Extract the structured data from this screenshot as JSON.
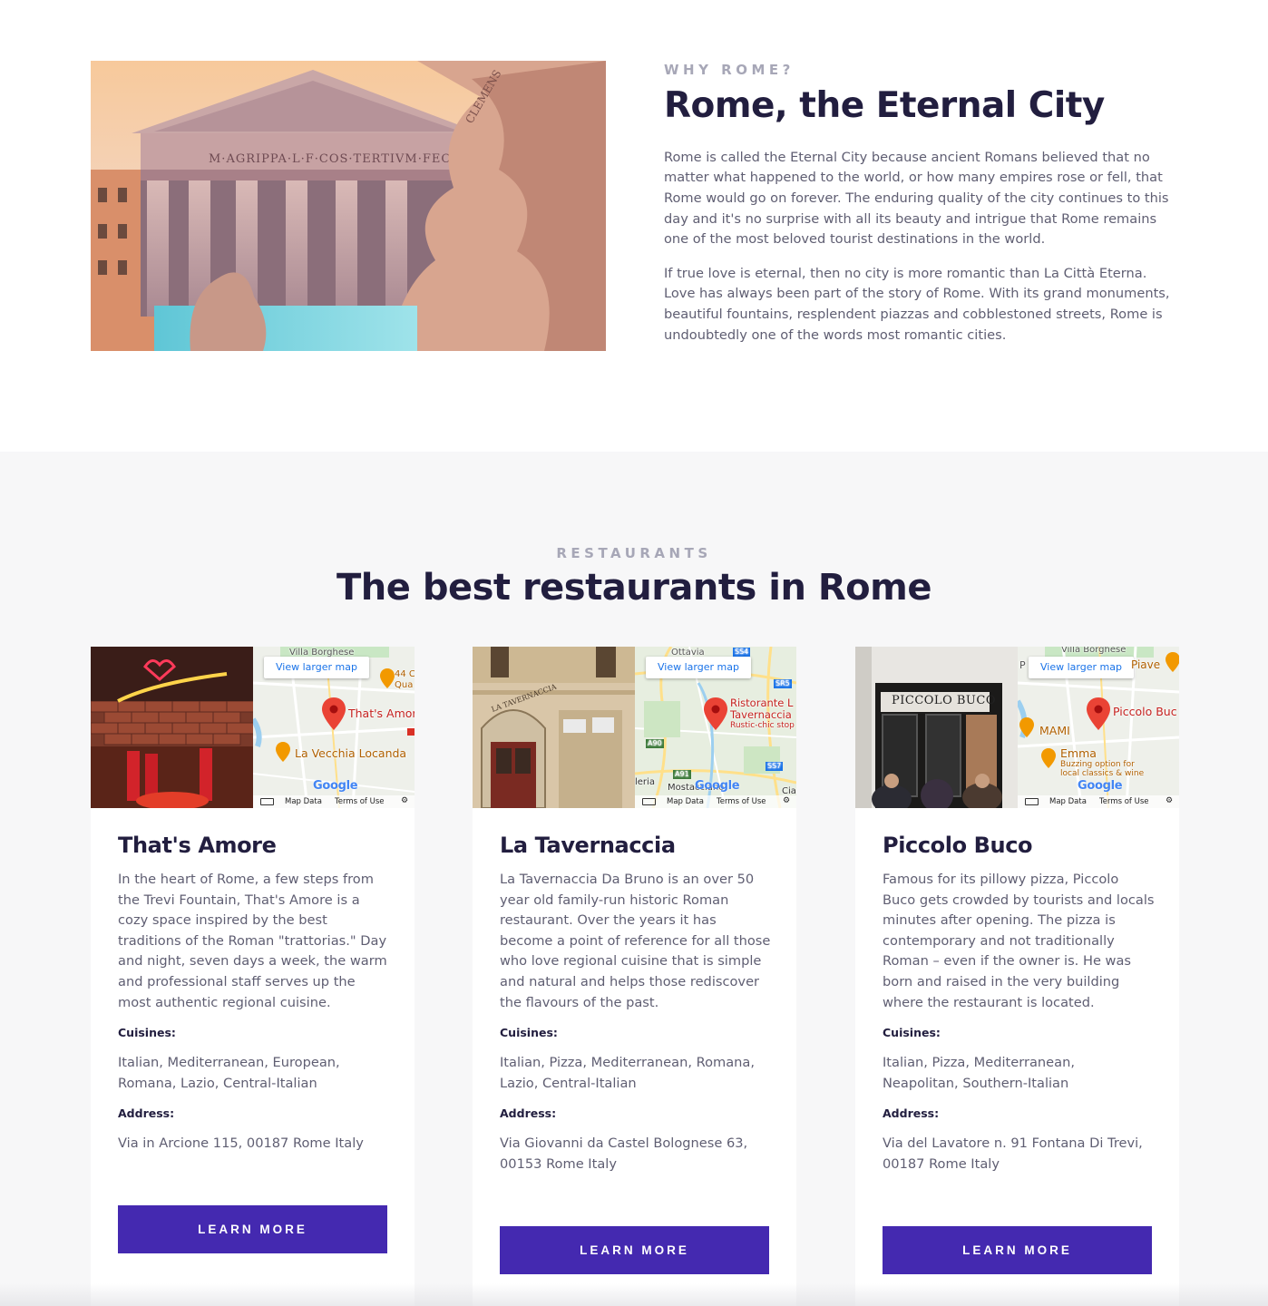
{
  "colors": {
    "accent": "#4429b0",
    "heading": "#221e3f",
    "body_text": "#5f5e72",
    "eyebrow": "#a7a7b7",
    "section_bg": "#f7f7f8"
  },
  "why": {
    "eyebrow": "WHY ROME?",
    "title": "Rome, the Eternal City",
    "paragraphs": [
      "Rome is called the Eternal City because ancient Romans believed that no matter what happened to the world, or how many empires rose or fell, that Rome would go on forever. The enduring quality of the city continues to this day and it's no surprise with all its beauty and intrigue that Rome remains one of the most beloved tourist destinations in the world.",
      "If true love is eternal, then no city is more romantic than La Città Eterna. Love has always been part of the story of Rome. With its grand monuments, beautiful fountains, resplendent piazzas and cobblestoned streets, Rome is undoubtedly one of the words most romantic cities."
    ],
    "image_inscription": "M·AGRIPPA·L·F·COS·TERTIVM·FECIT"
  },
  "restaurants": {
    "eyebrow": "RESTAURANTS",
    "title": "The best restaurants in Rome",
    "map_common": {
      "larger_map": "View larger map",
      "map_data": "Map Data",
      "terms": "Terms of Use",
      "google": "Google"
    },
    "cards": [
      {
        "name": "That's Amore",
        "description": "In the heart of Rome, a few steps from the Trevi Fountain, That's Amore is a cozy space inspired by the best traditions of the Roman \"trattorias.\" Day and night, seven days a week, the warm and professional staff serves up the most authentic regional cuisine.",
        "cuisines_label": "Cuisines:",
        "cuisines": "Italian, Mediterranean, European, Romana, Lazio, Central-Italian",
        "address_label": "Address:",
        "address": "Via in Arcione 115, 00187 Rome Italy",
        "button": "LEARN MORE",
        "map": {
          "top_label": "Villa Borghese",
          "pin_label": "That's Amor",
          "poi1": "La Vecchia Locanda",
          "poi2": "44 C",
          "poi2b": "Qua"
        }
      },
      {
        "name": "La Tavernaccia",
        "description": "La Tavernaccia Da Bruno is an over 50 year old family-run historic Roman restaurant. Over the years it has become a point of reference for all those who love regional cuisine that is simple and natural and helps those rediscover the flavours of the past.",
        "cuisines_label": "Cuisines:",
        "cuisines": "Italian, Pizza, Mediterranean, Romana, Lazio, Central-Italian",
        "address_label": "Address:",
        "address": "Via Giovanni da Castel Bolognese 63, 00153 Rome Italy",
        "button": "LEARN MORE",
        "map": {
          "top_label": "Ottavia",
          "pin_label": "Ristorante L",
          "pin_label2": "Tavernaccia",
          "pin_sub": "Rustic-chic stop",
          "road1": "SS4",
          "road2": "SR5",
          "road3": "A90",
          "road4": "A91",
          "road5": "SS7",
          "place1": "Mostacciano",
          "place2": "leria",
          "place3": "Cia"
        }
      },
      {
        "name": "Piccolo Buco",
        "description": "Famous for its pillowy pizza, Piccolo Buco gets crowded by tourists and locals minutes after opening. The pizza is contemporary and not traditionally Roman – even if the owner is. He was born and raised in the very building where the restaurant is located.",
        "cuisines_label": "Cuisines:",
        "cuisines": "Italian, Pizza, Mediterranean, Neapolitan, Southern-Italian",
        "address_label": "Address:",
        "address": "Via del Lavatore n. 91 Fontana Di Trevi, 00187 Rome Italy",
        "button": "LEARN MORE",
        "sign": "PICCOLO BUCO",
        "map": {
          "top_label": "Villa Borghese",
          "pin_label": "Piccolo Buc",
          "poi1": "MAMI",
          "poi2": "Emma",
          "poi2_sub1": "Buzzing option for",
          "poi2_sub2": "local classics & wine",
          "place1": "Piave",
          "place2": "P"
        }
      }
    ]
  }
}
